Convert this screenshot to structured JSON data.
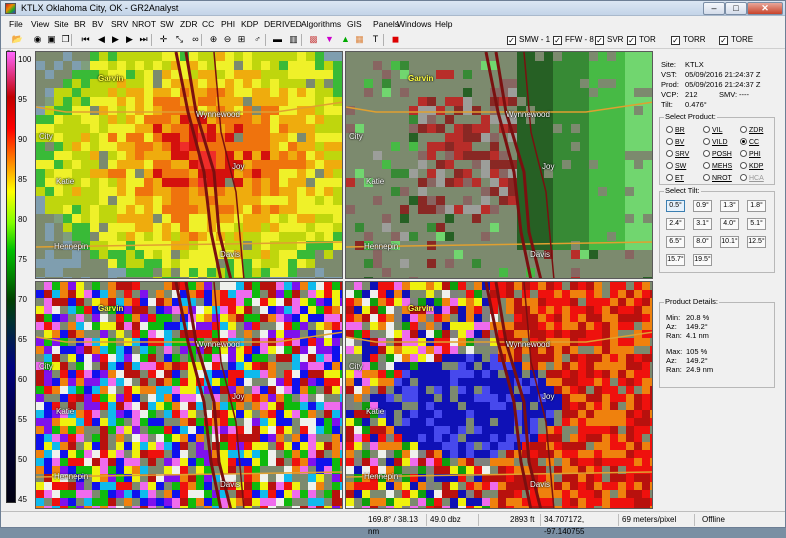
{
  "window": {
    "title": "KTLX Oklahoma City, OK - GR2Analyst",
    "min": "–",
    "max": "□",
    "close": "✕"
  },
  "menu": [
    "File",
    "View",
    "Site",
    "BR",
    "BV",
    "SRV",
    "NROT",
    "SW",
    "ZDR",
    "CC",
    "PHI",
    "KDP",
    "DERIVED",
    "Algorithms",
    "GIS",
    "Panels",
    "Windows",
    "Help"
  ],
  "toolbar": {
    "icons": [
      "open-icon",
      "globe-icon",
      "save-icon",
      "copy-icon",
      "skip-back-icon",
      "step-back-icon",
      "play-icon",
      "step-forward-icon",
      "skip-forward-icon",
      "crosshair-icon",
      "measure-icon",
      "link-icon",
      "zoom-in-icon",
      "zoom-out-icon",
      "zoom-region-icon",
      "probe-icon",
      "layout-1-icon",
      "layout-2-icon",
      "color-table-icon",
      "triangle-down-icon",
      "triangle-up-icon",
      "palette-icon",
      "text-icon",
      "stop-icon"
    ],
    "warnings": [
      {
        "label": "SMW - 1",
        "checked": true
      },
      {
        "label": "FFW - 8",
        "checked": true
      },
      {
        "label": "SVR",
        "checked": true
      },
      {
        "label": "TOR",
        "checked": true
      },
      {
        "label": "TORR",
        "checked": true
      },
      {
        "label": "TORE",
        "checked": true
      }
    ]
  },
  "colorbar": {
    "unit": "%",
    "labels": [
      "100",
      "95",
      "90",
      "85",
      "80",
      "75",
      "70",
      "65",
      "60",
      "55",
      "50",
      "45"
    ]
  },
  "map_labels": {
    "garvin": "Garvin",
    "wynnewood": "Wynnewood",
    "city": "City",
    "katie": "Katie",
    "joy": "Joy",
    "hennepin": "Hennepin",
    "davis": "Davis"
  },
  "info": {
    "site_label": "Site:",
    "site": "KTLX",
    "vst_label": "VST:",
    "vst": "05/09/2016  21:24:37 Z",
    "prod_label": "Prod:",
    "prod": "05/09/2016  21:24:37 Z",
    "vcp_label": "VCP:",
    "vcp": "212",
    "smv_label": "SMV:",
    "smv": "----",
    "tilt_label": "Tilt:",
    "tilt": "0.476°"
  },
  "select_product": {
    "title": "Select Product:",
    "items": [
      {
        "label": "BR",
        "selected": false,
        "disabled": false
      },
      {
        "label": "VIL",
        "selected": false,
        "disabled": false
      },
      {
        "label": "ZDR",
        "selected": false,
        "disabled": false
      },
      {
        "label": "BV",
        "selected": false,
        "disabled": false
      },
      {
        "label": "VILD",
        "selected": false,
        "disabled": false
      },
      {
        "label": "CC",
        "selected": true,
        "disabled": false
      },
      {
        "label": "SRV",
        "selected": false,
        "disabled": false
      },
      {
        "label": "POSH",
        "selected": false,
        "disabled": false
      },
      {
        "label": "PHI",
        "selected": false,
        "disabled": false
      },
      {
        "label": "SW",
        "selected": false,
        "disabled": false
      },
      {
        "label": "MEHS",
        "selected": false,
        "disabled": false
      },
      {
        "label": "KDP",
        "selected": false,
        "disabled": false
      },
      {
        "label": "ET",
        "selected": false,
        "disabled": false
      },
      {
        "label": "NROT",
        "selected": false,
        "disabled": false
      },
      {
        "label": "HCA",
        "selected": false,
        "disabled": true
      }
    ]
  },
  "select_tilt": {
    "title": "Select Tilt:",
    "tilts": [
      "0.5°",
      "0.9°",
      "1.3°",
      "1.8°",
      "2.4°",
      "3.1°",
      "4.0°",
      "5.1°",
      "6.5°",
      "8.0°",
      "10.1°",
      "12.5°",
      "15.7°",
      "19.5°"
    ],
    "selected": "0.5°"
  },
  "product_details": {
    "title": "Product Details:",
    "min_label": "Min:",
    "min": "20.8 %",
    "az_label": "Az:",
    "min_az": "149.2°",
    "ran_label": "Ran:",
    "min_ran": "4.1 nm",
    "max_label": "Max:",
    "max": "105 %",
    "max_az": "149.2°",
    "max_ran": "24.9 nm"
  },
  "status": {
    "azran": "169.8° / 38.13 nm",
    "value": "49.0 dbz",
    "height": "2893 ft",
    "latlon": "34.707172, -97.140755",
    "res": "69 meters/pixel",
    "mode": "Offline"
  }
}
